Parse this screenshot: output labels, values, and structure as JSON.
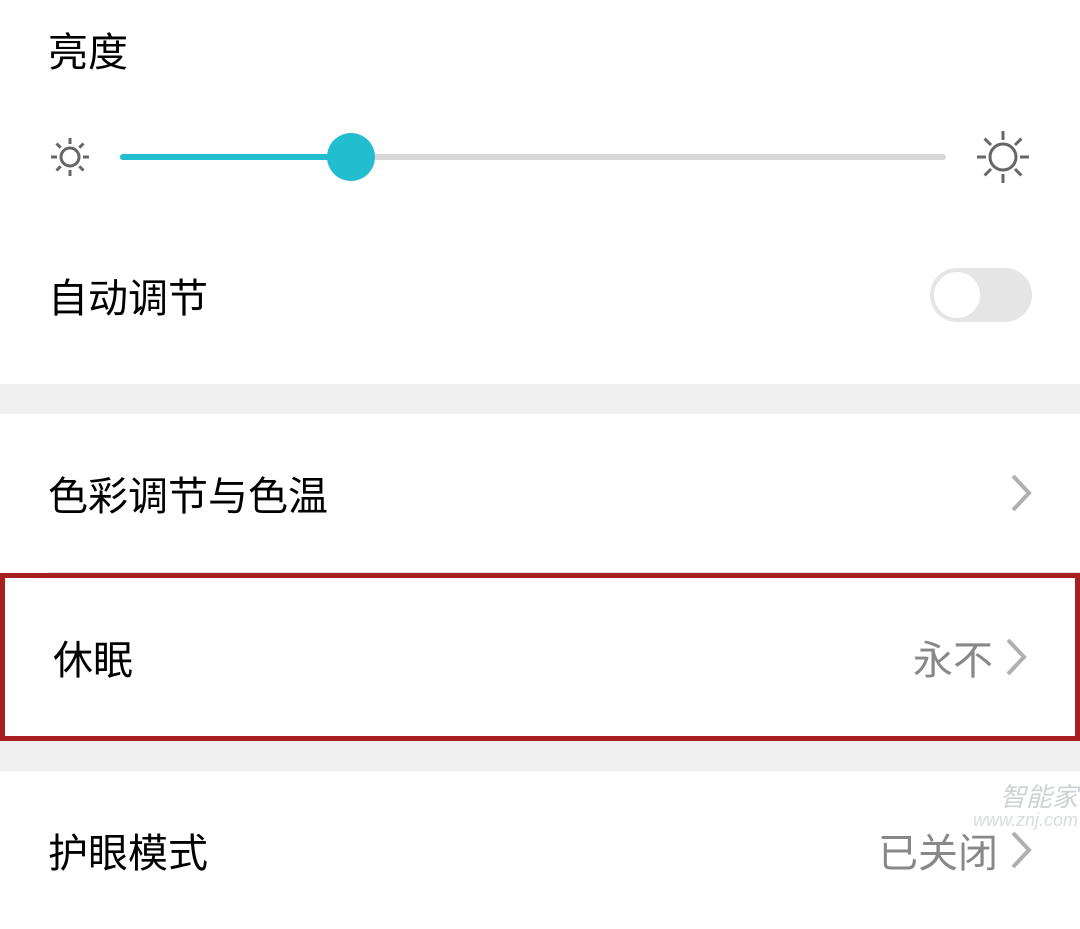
{
  "brightness": {
    "title": "亮度",
    "slider_percent": 28
  },
  "auto_adjust": {
    "label": "自动调节",
    "enabled": false
  },
  "rows": {
    "color": {
      "label": "色彩调节与色温"
    },
    "sleep": {
      "label": "休眠",
      "value": "永不"
    },
    "eye": {
      "label": "护眼模式",
      "value": "已关闭"
    }
  },
  "watermark": {
    "line1": "智能家",
    "line2": "www.znj.com"
  }
}
